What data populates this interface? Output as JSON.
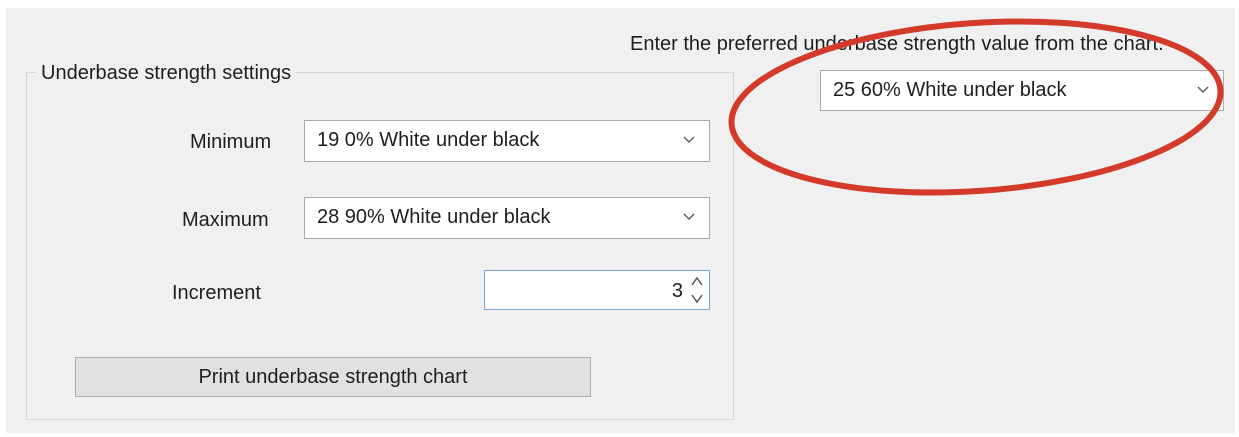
{
  "instruction": "Enter the preferred underbase strength value from the chart.",
  "preferred_select": {
    "value": "25 60% White under black"
  },
  "group": {
    "title": "Underbase strength settings",
    "minimum": {
      "label": "Minimum",
      "value": "19 0% White under black"
    },
    "maximum": {
      "label": "Maximum",
      "value": "28 90% White under black"
    },
    "increment": {
      "label": "Increment",
      "value": "3"
    },
    "print_button": "Print underbase strength chart"
  },
  "colors": {
    "annotation": "#d43a2a",
    "panel": "#f0f0f0",
    "focus_border": "#7aa7d6"
  },
  "icons": [
    "chevron-down-icon",
    "spin-up-icon",
    "spin-down-icon"
  ]
}
